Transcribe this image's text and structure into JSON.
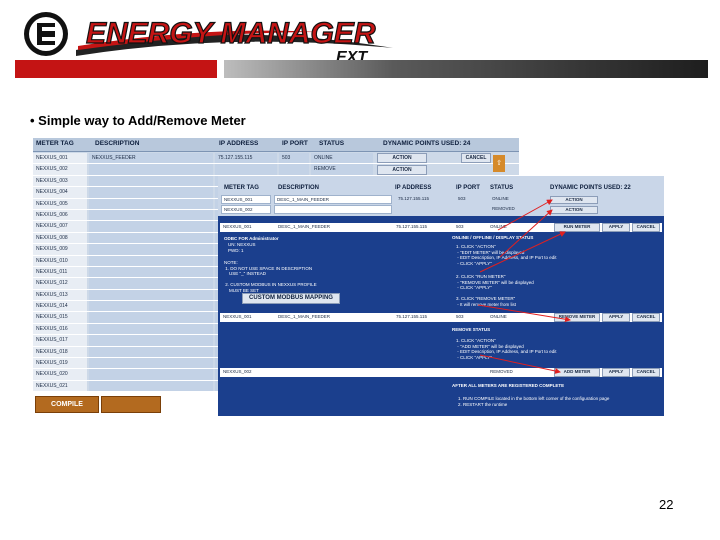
{
  "brand": {
    "logo_mark": "EIG",
    "title": "ENERGY MANAGER",
    "suffix": "EXT",
    "colors": {
      "red": "#c41414",
      "dark": "#1e1e1e"
    }
  },
  "bullet": "• Simple way to Add/Remove Meter",
  "page_number": "22",
  "back": {
    "headers": {
      "tag": "METER TAG",
      "desc": "DESCRIPTION",
      "ip": "IP ADDRESS",
      "port": "IP PORT",
      "status": "STATUS",
      "points": "DYNAMIC POINTS USED: 24"
    },
    "rows": [
      {
        "tag": "NEXXUS_001",
        "desc": "NEXXUS_FEEDER",
        "ip": "75.127.155.115",
        "port": "503",
        "status": "ONLINE"
      },
      {
        "tag": "NEXXUS_002",
        "desc": "",
        "ip": "",
        "port": "",
        "status": "REMOVE"
      },
      {
        "tag": "NEXXUS_003"
      },
      {
        "tag": "NEXXUS_004"
      },
      {
        "tag": "NEXXUS_005"
      },
      {
        "tag": "NEXXUS_006"
      },
      {
        "tag": "NEXXUS_007"
      },
      {
        "tag": "NEXXUS_008"
      },
      {
        "tag": "NEXXUS_009"
      },
      {
        "tag": "NEXXUS_010"
      },
      {
        "tag": "NEXXUS_011"
      },
      {
        "tag": "NEXXUS_012"
      },
      {
        "tag": "NEXXUS_013"
      },
      {
        "tag": "NEXXUS_014"
      },
      {
        "tag": "NEXXUS_015"
      },
      {
        "tag": "NEXXUS_016"
      },
      {
        "tag": "NEXXUS_017"
      },
      {
        "tag": "NEXXUS_018"
      },
      {
        "tag": "NEXXUS_019"
      },
      {
        "tag": "NEXXUS_020"
      },
      {
        "tag": "NEXXUS_021"
      }
    ],
    "action_label": "ACTION",
    "cancel_label": "CANCEL",
    "up_label": "⇧",
    "compile_label": "COMPILE"
  },
  "front": {
    "headers": {
      "tag": "METER TAG",
      "desc": "DESCRIPTION",
      "ip": "IP ADDRESS",
      "port": "IP PORT",
      "status": "STATUS",
      "points": "DYNAMIC POINTS USED: 22"
    },
    "rows": [
      {
        "tag": "NEXXUS_001",
        "desc": "DESC_1_MAIN_FEEDER",
        "ip": "75.127.155.115",
        "port": "503",
        "status": "ONLINE",
        "action": "ACTION"
      },
      {
        "tag": "NEXXUS_002",
        "desc": "",
        "ip": "",
        "port": "",
        "status": "REMOVED",
        "action": "ACTION"
      }
    ],
    "edit_row": {
      "tag": "NEXXUS_001",
      "desc": "DESC_1_MAIN_FEEDER",
      "ip": "75.127.155.115",
      "port": "503",
      "status": "ONLINE",
      "btn1": "RUN METER",
      "btn2": "APPLY",
      "btn3": "CANCEL"
    },
    "remove_row": {
      "tag": "NEXXUS_001",
      "desc": "DESC_1_MAIN_FEEDER",
      "ip": "75.127.155.115",
      "port": "503",
      "status": "ONLINE",
      "btn1": "REMOVE METER",
      "btn2": "APPLY",
      "btn3": "CANCEL"
    },
    "add_row": {
      "tag": "NEXXUS_002",
      "status": "REMOVED",
      "btn1": "ADD METER",
      "btn2": "APPLY",
      "btn3": "CANCEL"
    },
    "notes": {
      "left_title": "ODBC FOR Administrator",
      "left_1": "UN: NEXXUS\nPWD: 1",
      "left_2": "NOTE:\n 1. DO NOT USE SPACE IN DESCRIPTION\n    USE \"_\" INSTEAD",
      "left_3": " 2. CUSTOM MODBUS IN NEXXUS PROFILE\n    MUST BE SET",
      "custom_modbus": "CUSTOM MODBUS MAPPING",
      "online_title": "ONLINE / OFFLINE / DISPLAY STATUS",
      "online_1": "1. CLICK \"ACTION\"\n - \"EDIT METER\" will be displayed\n - EDIT Description, IP Address, and IP Port to edit\n - CLICK \"APPLY\"",
      "online_2": "2. CLICK \"RUN METER\"\n - \"REMOVE METER\" will be displayed\n - CLICK \"APPLY\"",
      "online_3": "3. CLICK \"REMOVE METER\"\n - It will remove meter from list",
      "remove_title": "REMOVE STATUS",
      "remove_1": "1. CLICK \"ACTION\"\n - \"ADD METER\" will be displayed\n - EDIT Description, IP Address, and IP Port to edit\n - CLICK \"APPLY\"",
      "after_title": "AFTER ALL METERS ARE REGISTERED COMPLETE",
      "after_1": "1. RUN COMPILE located in the bottom left corner of the configuration page\n2. RESTART the runtime"
    }
  }
}
